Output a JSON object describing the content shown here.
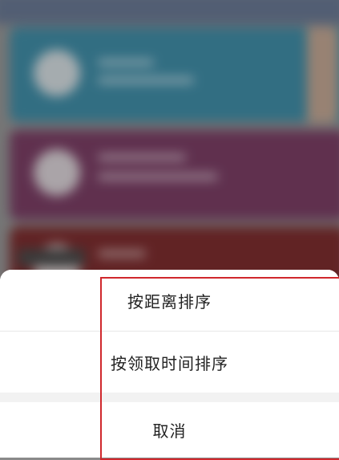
{
  "action_sheet": {
    "option_sort_by_distance": "按距离排序",
    "option_sort_by_claim_time": "按领取时间排序",
    "cancel_label": "取消"
  },
  "colors": {
    "highlight": "#d0282d",
    "sheet_background": "#ffffff",
    "text": "#222222"
  }
}
